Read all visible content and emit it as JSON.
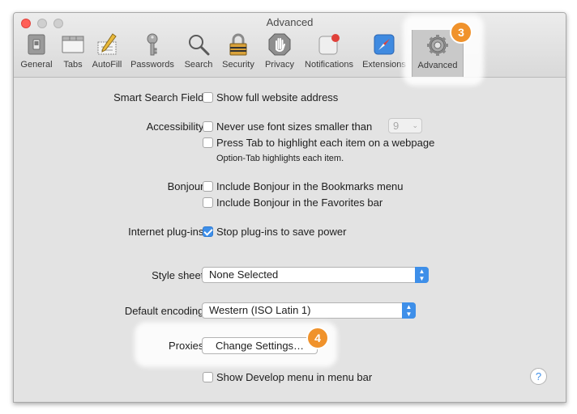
{
  "window": {
    "title": "Advanced"
  },
  "toolbar": {
    "tabs": [
      {
        "label": "General",
        "icon": "switch-icon"
      },
      {
        "label": "Tabs",
        "icon": "tabs-icon"
      },
      {
        "label": "AutoFill",
        "icon": "pencil-form-icon"
      },
      {
        "label": "Passwords",
        "icon": "key-icon"
      },
      {
        "label": "Search",
        "icon": "magnifier-icon"
      },
      {
        "label": "Security",
        "icon": "padlock-icon"
      },
      {
        "label": "Privacy",
        "icon": "hand-icon"
      },
      {
        "label": "Notifications",
        "icon": "notification-icon"
      },
      {
        "label": "Extensions",
        "icon": "compass-icon"
      },
      {
        "label": "Advanced",
        "icon": "gear-icon",
        "selected": true
      }
    ]
  },
  "callouts": {
    "advanced_step": "3",
    "proxies_step": "4",
    "color": "#f0922b"
  },
  "settings": {
    "smart_search": {
      "label": "Smart Search Field:",
      "options": [
        {
          "text": "Show full website address",
          "checked": false
        }
      ]
    },
    "accessibility": {
      "label": "Accessibility:",
      "options": [
        {
          "text": "Never use font sizes smaller than",
          "checked": false
        },
        {
          "text": "Press Tab to highlight each item on a webpage",
          "checked": false
        }
      ],
      "font_size_value": "9",
      "note": "Option-Tab highlights each item."
    },
    "bonjour": {
      "label": "Bonjour:",
      "options": [
        {
          "text": "Include Bonjour in the Bookmarks menu",
          "checked": false
        },
        {
          "text": "Include Bonjour in the Favorites bar",
          "checked": false
        }
      ]
    },
    "plugins": {
      "label": "Internet plug-ins:",
      "options": [
        {
          "text": "Stop plug-ins to save power",
          "checked": true
        }
      ]
    },
    "style_sheet": {
      "label": "Style sheet:",
      "value": "None Selected"
    },
    "encoding": {
      "label": "Default encoding:",
      "value": "Western (ISO Latin 1)"
    },
    "proxies": {
      "label": "Proxies:",
      "button": "Change Settings…"
    },
    "develop": {
      "options": [
        {
          "text": "Show Develop menu in menu bar",
          "checked": false
        }
      ]
    },
    "help": "?"
  },
  "colors": {
    "accent": "#3e8fe9"
  }
}
